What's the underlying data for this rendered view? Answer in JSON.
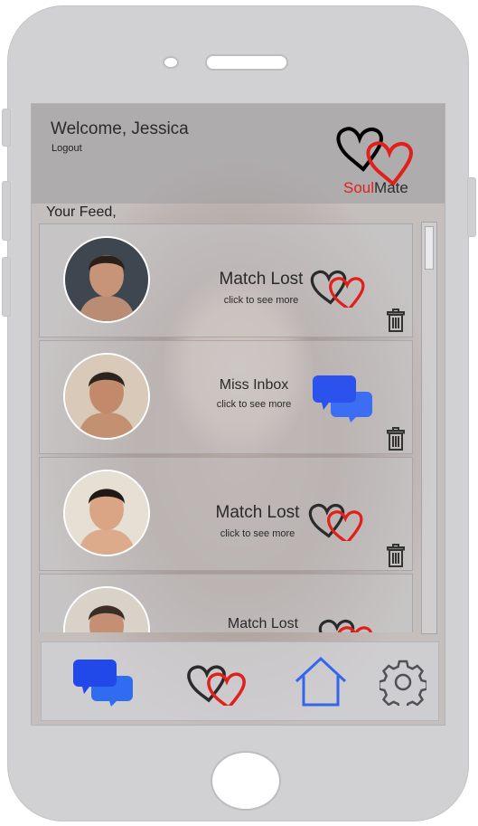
{
  "header": {
    "welcome": "Welcome, Jessica",
    "logout": "Logout"
  },
  "logo": {
    "part1": "Soul",
    "part2": "Mate",
    "color1": "#e0201a",
    "color2": "#2d2d2d"
  },
  "feed": {
    "label": "Your Feed,",
    "items": [
      {
        "title": "Match Lost",
        "subtitle": "click to see more",
        "icon": "broken-hearts-icon",
        "avatar_skin": "#c89478",
        "avatar_bg": "#3e4650",
        "avatar_hair": "#2a2019"
      },
      {
        "title": "Miss Inbox",
        "subtitle": "click to see more",
        "icon": "chat-bubbles-icon",
        "avatar_skin": "#c28a6a",
        "avatar_bg": "#d8c9b9",
        "avatar_hair": "#2b241f"
      },
      {
        "title": "Match Lost",
        "subtitle": "click to see more",
        "icon": "broken-hearts-icon",
        "avatar_skin": "#d9a584",
        "avatar_bg": "#e6dfd4",
        "avatar_hair": "#1f1a17"
      },
      {
        "title": "Match Lost",
        "subtitle": "",
        "icon": "broken-hearts-icon",
        "avatar_skin": "#c48f72",
        "avatar_bg": "#d9d2c8",
        "avatar_hair": "#3a2e26"
      }
    ]
  },
  "tabbar": {
    "tabs": [
      {
        "icon": "chat-bubbles-icon"
      },
      {
        "icon": "hearts-icon"
      },
      {
        "icon": "home-icon"
      },
      {
        "icon": "gear-icon"
      }
    ]
  },
  "colors": {
    "heart_red": "#e0201a",
    "heart_dark": "#2b2b2b",
    "chat_blue": "#2f5cf0",
    "home_blue": "#3366ee",
    "gear_gray": "#505055"
  }
}
